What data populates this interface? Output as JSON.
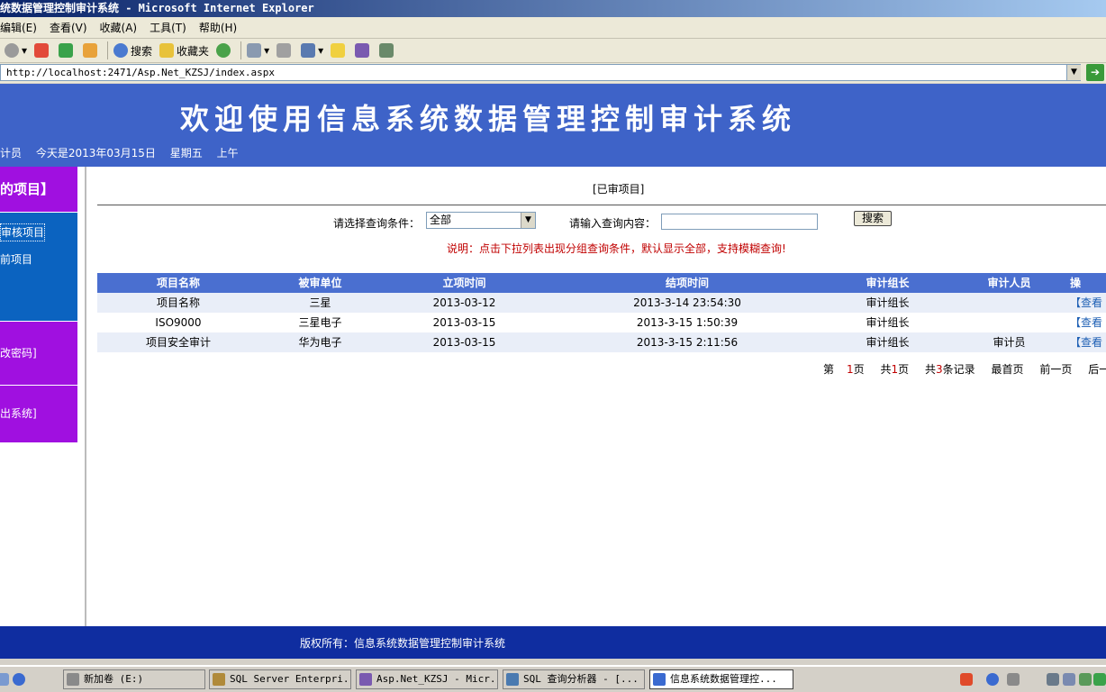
{
  "window": {
    "title": "统数据管理控制审计系统 - Microsoft Internet Explorer"
  },
  "menu": [
    "编辑(E)",
    "查看(V)",
    "收藏(A)",
    "工具(T)",
    "帮助(H)"
  ],
  "toolbar": {
    "search": "搜索",
    "favorites": "收藏夹"
  },
  "address": {
    "url": "http://localhost:2471/Asp.Net_KZSJ/index.aspx"
  },
  "banner": {
    "title": "欢迎使用信息系统数据管理控制审计系统",
    "role": "计员",
    "date": "今天是2013年03月15日",
    "weekday": "星期五",
    "period": "上午"
  },
  "sidebar": {
    "head": "的项目】",
    "links": [
      "审核项目",
      "前项目"
    ],
    "change_password": "改密码]",
    "exit": "出系统]"
  },
  "main": {
    "section_title": "[已审项目]",
    "query_label": "请选择查询条件：",
    "query_select": "全部",
    "content_label": "请输入查询内容：",
    "content_value": "",
    "search_button": "搜索",
    "note": "说明：点击下拉列表出现分组查询条件，默认显示全部，支持模糊查询!"
  },
  "table": {
    "headers": [
      "项目名称",
      "被审单位",
      "立项时间",
      "结项时间",
      "审计组长",
      "审计人员",
      "操"
    ],
    "rows": [
      [
        "项目名称",
        "三星",
        "2013-03-12",
        "2013-3-14 23:54:30",
        "审计组长",
        "",
        "【查看"
      ],
      [
        "ISO9000",
        "三星电子",
        "2013-03-15",
        "2013-3-15 1:50:39",
        "审计组长",
        "",
        "【查看"
      ],
      [
        "项目安全审计",
        "华为电子",
        "2013-03-15",
        "2013-3-15 2:11:56",
        "审计组长",
        "审计员",
        "【查看"
      ]
    ]
  },
  "pager": {
    "page_pre": "第",
    "page_num": "1",
    "page_post": "页",
    "total_pre": "共",
    "total_num": "1",
    "total_post": "页",
    "rec_pre": "共",
    "rec_num": "3",
    "rec_post": "条记录",
    "first": "最首页",
    "prev": "前一页",
    "next": "后一页"
  },
  "footer": {
    "copyright": "版权所有：信息系统数据管理控制审计系统"
  },
  "taskbar": [
    "新加卷 (E:)",
    "SQL Server Enterpri...",
    "Asp.Net_KZSJ - Micr...",
    "SQL 查询分析器 - [...",
    "信息系统数据管理控..."
  ],
  "colors": {
    "banner": "#3e63c8",
    "sidebar_purple": "#a010e0",
    "sidebar_blue": "#0b63c0",
    "footer": "#0f2da0",
    "header_row": "#4a6fd0",
    "note": "#c00000"
  }
}
